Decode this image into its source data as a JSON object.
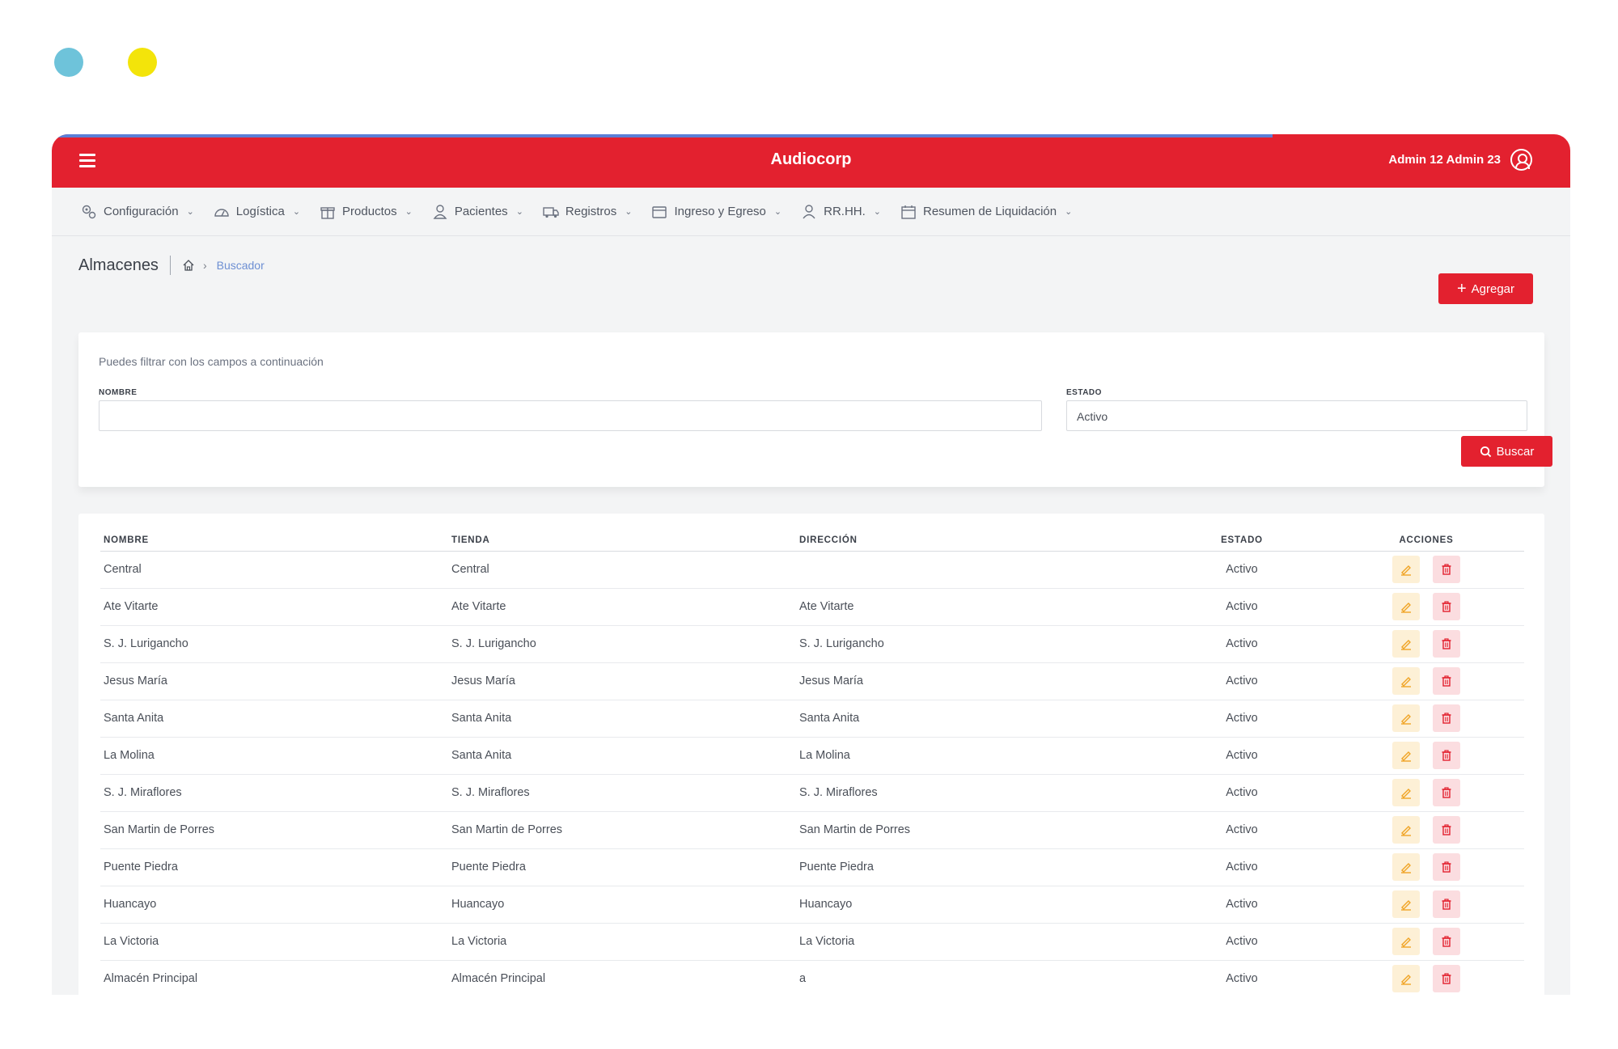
{
  "header": {
    "app_title": "Audiocorp",
    "user_name": "Admin 12 Admin 23",
    "brand_color": "#e3212f"
  },
  "nav": {
    "items": [
      {
        "label": "Configuración",
        "icon": "gears-icon"
      },
      {
        "label": "Logística",
        "icon": "gauge-icon"
      },
      {
        "label": "Productos",
        "icon": "gift-icon"
      },
      {
        "label": "Pacientes",
        "icon": "users-icon"
      },
      {
        "label": "Registros",
        "icon": "truck-icon"
      },
      {
        "label": "Ingreso y Egreso",
        "icon": "wallet-icon"
      },
      {
        "label": "RR.HH.",
        "icon": "user-icon"
      },
      {
        "label": "Resumen de Liquidación",
        "icon": "calendar-icon"
      }
    ]
  },
  "breadcrumb": {
    "title": "Almacenes",
    "current": "Buscador"
  },
  "actions": {
    "add_label": "Agregar",
    "search_label": "Buscar"
  },
  "filter": {
    "hint": "Puedes filtrar con los campos a continuación",
    "nombre_label": "NOMBRE",
    "nombre_value": "",
    "estado_label": "ESTADO",
    "estado_value": "Activo"
  },
  "table": {
    "columns": [
      "NOMBRE",
      "TIENDA",
      "DIRECCIÓN",
      "ESTADO",
      "ACCIONES"
    ],
    "rows": [
      {
        "nombre": "Central",
        "tienda": "Central",
        "direccion": "",
        "estado": "Activo"
      },
      {
        "nombre": "Ate Vitarte",
        "tienda": "Ate Vitarte",
        "direccion": "Ate Vitarte",
        "estado": "Activo"
      },
      {
        "nombre": "S. J. Lurigancho",
        "tienda": "S. J. Lurigancho",
        "direccion": "S. J. Lurigancho",
        "estado": "Activo"
      },
      {
        "nombre": "Jesus María",
        "tienda": "Jesus María",
        "direccion": "Jesus María",
        "estado": "Activo"
      },
      {
        "nombre": "Santa Anita",
        "tienda": "Santa Anita",
        "direccion": "Santa Anita",
        "estado": "Activo"
      },
      {
        "nombre": "La Molina",
        "tienda": "Santa Anita",
        "direccion": "La Molina",
        "estado": "Activo"
      },
      {
        "nombre": "S. J. Miraflores",
        "tienda": "S. J. Miraflores",
        "direccion": "S. J. Miraflores",
        "estado": "Activo"
      },
      {
        "nombre": "San Martin de Porres",
        "tienda": "San Martin de Porres",
        "direccion": "San Martin de Porres",
        "estado": "Activo"
      },
      {
        "nombre": "Puente Piedra",
        "tienda": "Puente Piedra",
        "direccion": "Puente Piedra",
        "estado": "Activo"
      },
      {
        "nombre": "Huancayo",
        "tienda": "Huancayo",
        "direccion": "Huancayo",
        "estado": "Activo"
      },
      {
        "nombre": "La Victoria",
        "tienda": "La Victoria",
        "direccion": "La Victoria",
        "estado": "Activo"
      },
      {
        "nombre": "Almacén Principal",
        "tienda": "Almacén Principal",
        "direccion": "a",
        "estado": "Activo"
      }
    ]
  }
}
